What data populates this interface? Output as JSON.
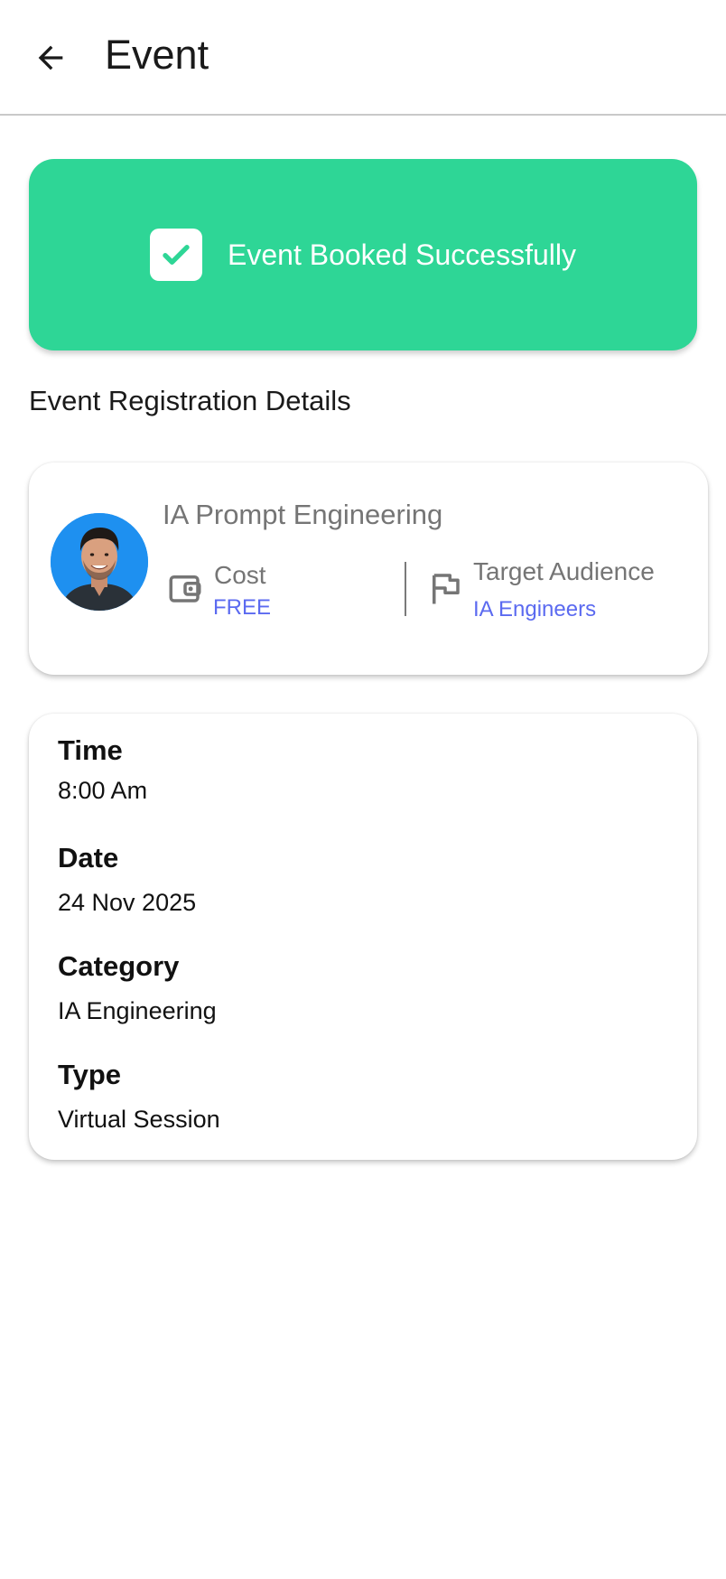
{
  "appbar": {
    "title": "Event",
    "back_icon": "arrow-left-icon"
  },
  "banner": {
    "text": "Event Booked Successfully",
    "icon": "check-icon",
    "color": "#2ed696"
  },
  "section": {
    "title": "Event Registration Details"
  },
  "event": {
    "name": "IA Prompt Engineering",
    "cost_label": "Cost",
    "cost_value": "FREE",
    "audience_label": "Target Audience",
    "audience_value": "IA Engineers",
    "cost_icon": "wallet-icon",
    "audience_icon": "flag-icon",
    "accent_color": "#5b6af0"
  },
  "details": {
    "time_label": "Time",
    "time_value": "8:00 Am",
    "date_label": "Date",
    "date_value": "24 Nov 2025",
    "category_label": "Category",
    "category_value": "IA Engineering",
    "type_label": "Type",
    "type_value": "Virtual Session"
  }
}
